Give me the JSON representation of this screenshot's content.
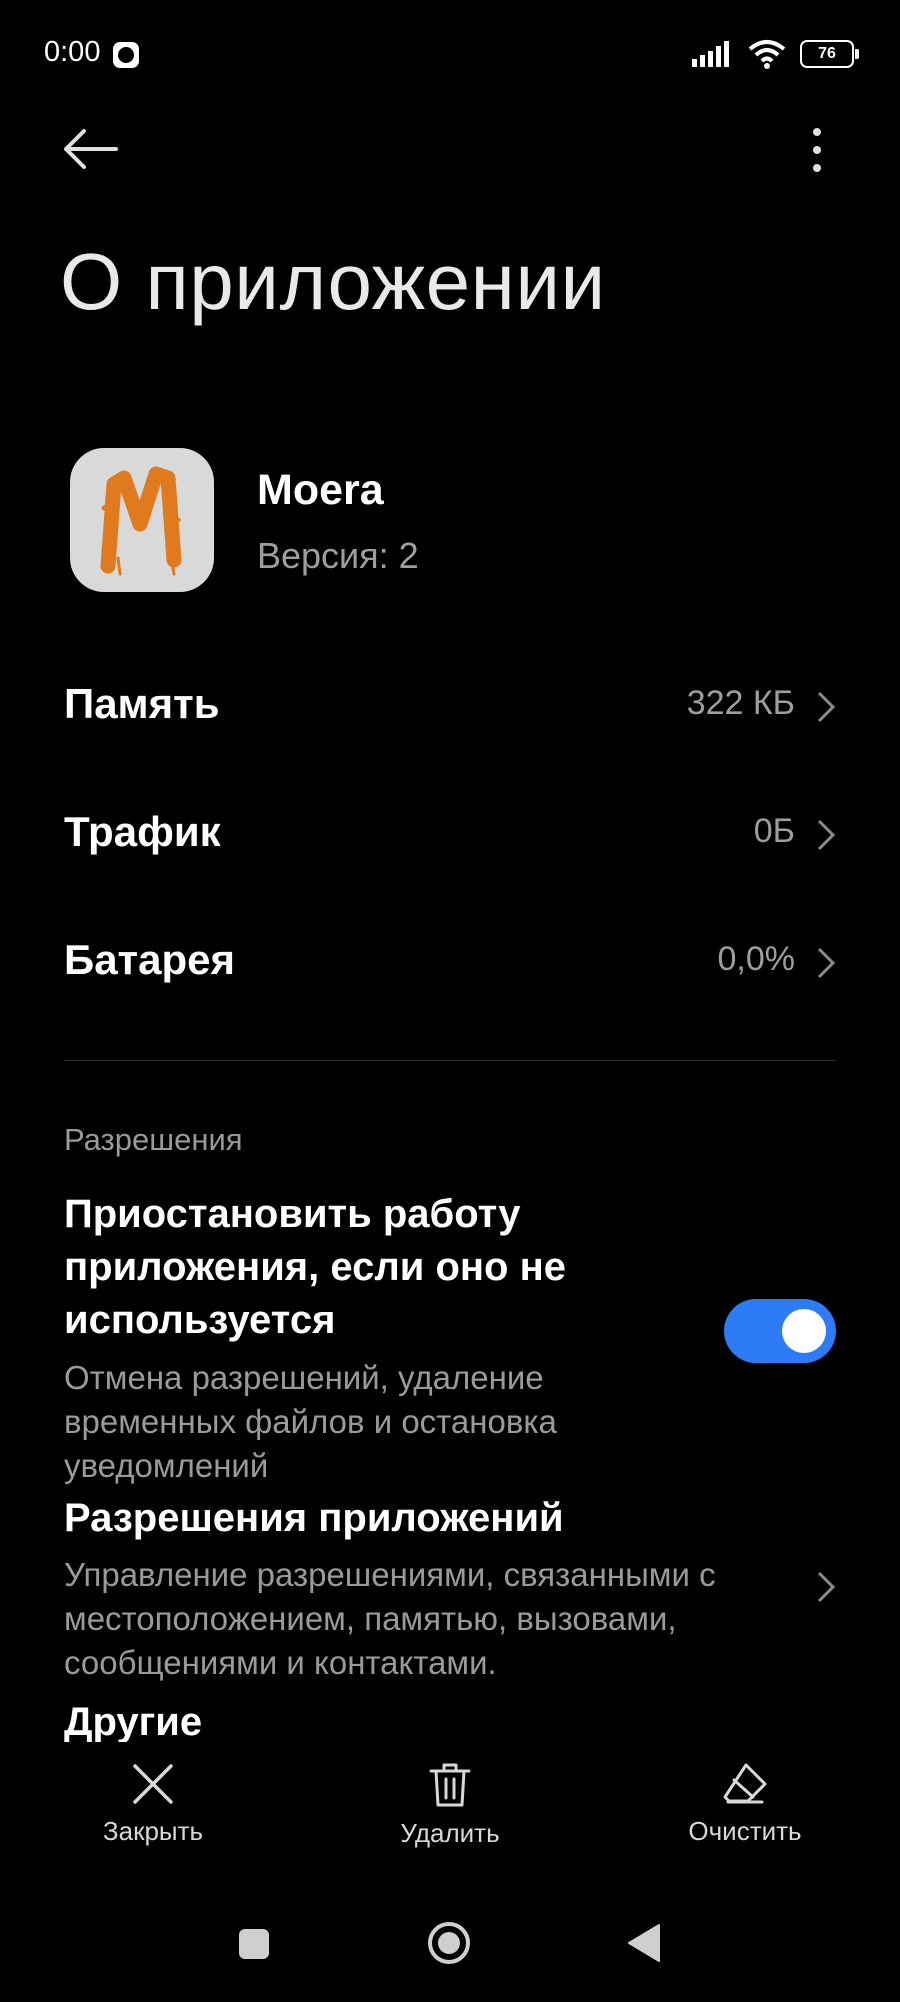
{
  "status_bar": {
    "time": "0:00",
    "battery": "76"
  },
  "header": {
    "title": "О приложении"
  },
  "app": {
    "name": "Moera",
    "version": "Версия: 2",
    "icon_color": "#d9d9d9",
    "brand_color": "#e07a1f"
  },
  "rows": [
    {
      "label": "Память",
      "value": "322 КБ"
    },
    {
      "label": "Трафик",
      "value": "0Б"
    },
    {
      "label": "Батарея",
      "value": "0,0%"
    }
  ],
  "permissions": {
    "section_label": "Разрешения",
    "pause_title": "Приостановить работу приложения, если оно не используется",
    "pause_desc": "Отмена разрешений, удаление временных файлов и остановка уведомлений",
    "pause_enabled": true,
    "app_perms_title": "Разрешения приложений",
    "app_perms_desc": "Управление разрешениями, связанными с местоположением, памятью, вызовами, сообщениями и контактами.",
    "other_title": "Другие"
  },
  "actions": {
    "close": "Закрыть",
    "delete": "Удалить",
    "clear": "Очистить"
  },
  "colors": {
    "toggle_on": "#2e7bf6",
    "background": "#000000",
    "secondary_text": "#9e9e9e"
  }
}
